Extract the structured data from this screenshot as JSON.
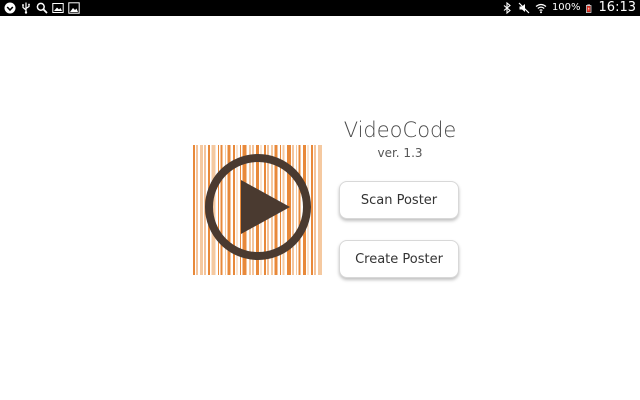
{
  "status_bar": {
    "left_icons": [
      "notification-icon",
      "usb-icon",
      "search-icon",
      "gallery-icon",
      "image-icon"
    ],
    "right_icons": [
      "bluetooth-icon",
      "mute-icon",
      "wifi-icon",
      "battery-icon"
    ],
    "battery": "100%",
    "time": "16:13"
  },
  "app": {
    "title": "VideoCode",
    "version": "ver. 1.3",
    "logo_icon": "barcode-play-logo-icon"
  },
  "buttons": {
    "scan": "Scan Poster",
    "create": "Create Poster"
  },
  "colors": {
    "barcode_orange": "#e8893a",
    "play_dark": "#4a3a30",
    "status_bar": "#000000"
  }
}
